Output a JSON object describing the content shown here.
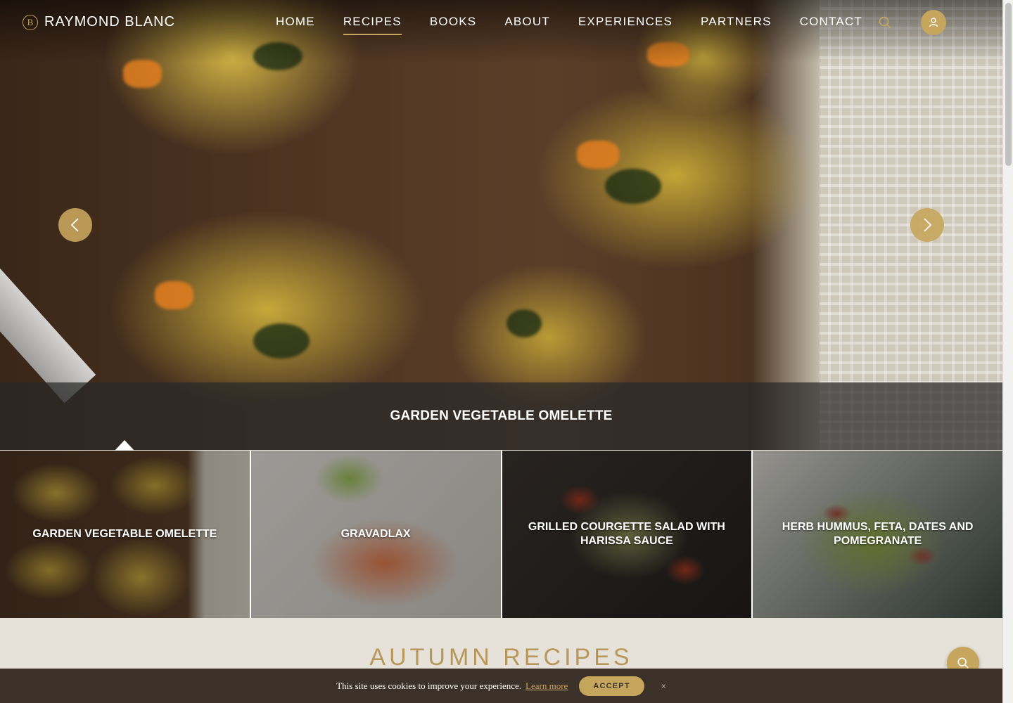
{
  "brand": {
    "logo_letter": "B",
    "name": "RAYMOND BLANC"
  },
  "nav": {
    "items": [
      {
        "label": "HOME",
        "active": false
      },
      {
        "label": "RECIPES",
        "active": true
      },
      {
        "label": "BOOKS",
        "active": false
      },
      {
        "label": "ABOUT",
        "active": false
      },
      {
        "label": "EXPERIENCES",
        "active": false
      },
      {
        "label": "PARTNERS",
        "active": false
      },
      {
        "label": "CONTACT",
        "active": false
      }
    ],
    "search_icon": "search-icon",
    "account_icon": "user-icon"
  },
  "hero": {
    "caption": "GARDEN VEGETABLE OMELETTE",
    "prev_icon": "chevron-left-icon",
    "next_icon": "chevron-right-icon"
  },
  "thumbnails": [
    {
      "title": "GARDEN VEGETABLE OMELETTE",
      "selected": true
    },
    {
      "title": "GRAVADLAX",
      "selected": false
    },
    {
      "title": "GRILLED COURGETTE SALAD WITH HARISSA SAUCE",
      "selected": false
    },
    {
      "title": "HERB HUMMUS, FETA, DATES AND POMEGRANATE",
      "selected": false
    }
  ],
  "section": {
    "title": "AUTUMN RECIPES"
  },
  "cookies": {
    "text": "This site uses cookies to improve your experience.",
    "link": "Learn more",
    "accept": "ACCEPT",
    "close": "×"
  },
  "colors": {
    "accent": "#c6a55c",
    "section_title": "#b8975a",
    "cookie_bar": "#3c3129",
    "page_bg": "#e6e2d9"
  }
}
